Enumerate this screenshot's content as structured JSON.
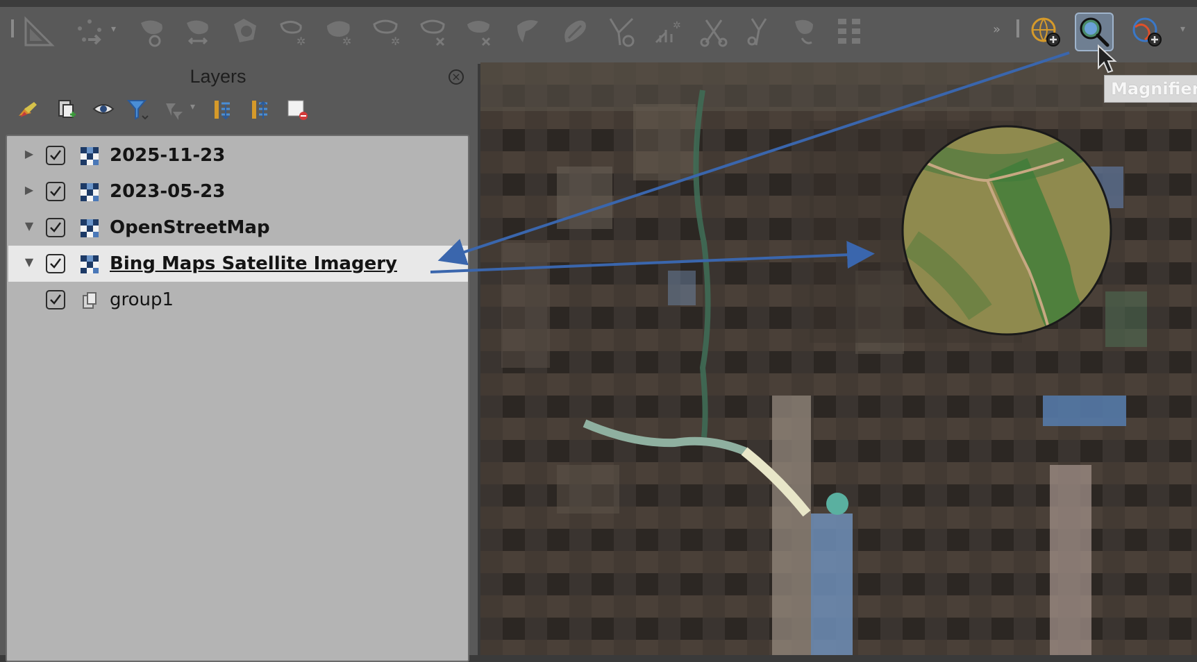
{
  "app": {
    "panel_title": "Layers"
  },
  "toolbar": {
    "buttons": [
      {
        "icon": "measure-icon"
      },
      {
        "icon": "move-feature-icon"
      },
      {
        "icon": "rotate-feature-icon"
      },
      {
        "icon": "simplify-feature-icon"
      },
      {
        "icon": "add-ring-icon"
      },
      {
        "icon": "add-part-icon"
      },
      {
        "icon": "fill-ring-icon"
      },
      {
        "icon": "delete-ring-icon"
      },
      {
        "icon": "delete-part-icon"
      },
      {
        "icon": "reshape-features-icon"
      },
      {
        "icon": "offset-curve-icon"
      },
      {
        "icon": "split-features-icon"
      },
      {
        "icon": "split-parts-icon"
      },
      {
        "icon": "merge-features-icon"
      },
      {
        "icon": "merge-attributes-icon"
      },
      {
        "icon": "rotate-point-symbols-icon"
      },
      {
        "icon": "offset-point-symbols-icon"
      },
      {
        "icon": "tile-grid-icon"
      },
      {
        "icon": "zoom-globe-icon"
      },
      {
        "icon": "magnifier-icon",
        "active": true
      },
      {
        "icon": "zoom-globe-color-icon"
      }
    ],
    "tooltip": "Magnifier"
  },
  "layers_toolbar": {
    "buttons": [
      {
        "icon": "style-panel-icon"
      },
      {
        "icon": "add-group-icon"
      },
      {
        "icon": "visibility-icon"
      },
      {
        "icon": "filter-legend-icon"
      },
      {
        "icon": "filter-expression-icon"
      },
      {
        "icon": "expand-all-icon"
      },
      {
        "icon": "collapse-all-icon"
      },
      {
        "icon": "remove-layer-icon"
      }
    ]
  },
  "layers": [
    {
      "name": "2025-11-23",
      "checked": true,
      "expander": "collapsed",
      "bold": true,
      "icon": "raster-layer-icon"
    },
    {
      "name": "2023-05-23",
      "checked": true,
      "expander": "collapsed",
      "bold": true,
      "icon": "raster-layer-icon"
    },
    {
      "name": "OpenStreetMap",
      "checked": true,
      "expander": "expanded",
      "bold": true,
      "icon": "raster-layer-icon"
    },
    {
      "name": "Bing Maps Satellite Imagery",
      "checked": true,
      "expander": "expanded",
      "bold": true,
      "selected": true,
      "underline": true,
      "icon": "raster-layer-icon"
    },
    {
      "name": "group1",
      "checked": true,
      "expander": "none",
      "bold": false,
      "icon": "group-icon"
    }
  ],
  "colors": {
    "annotation_arrow": "#3a66ad",
    "selected_row": "#e8e8e8",
    "tree_bg": "#b4b4b4"
  }
}
